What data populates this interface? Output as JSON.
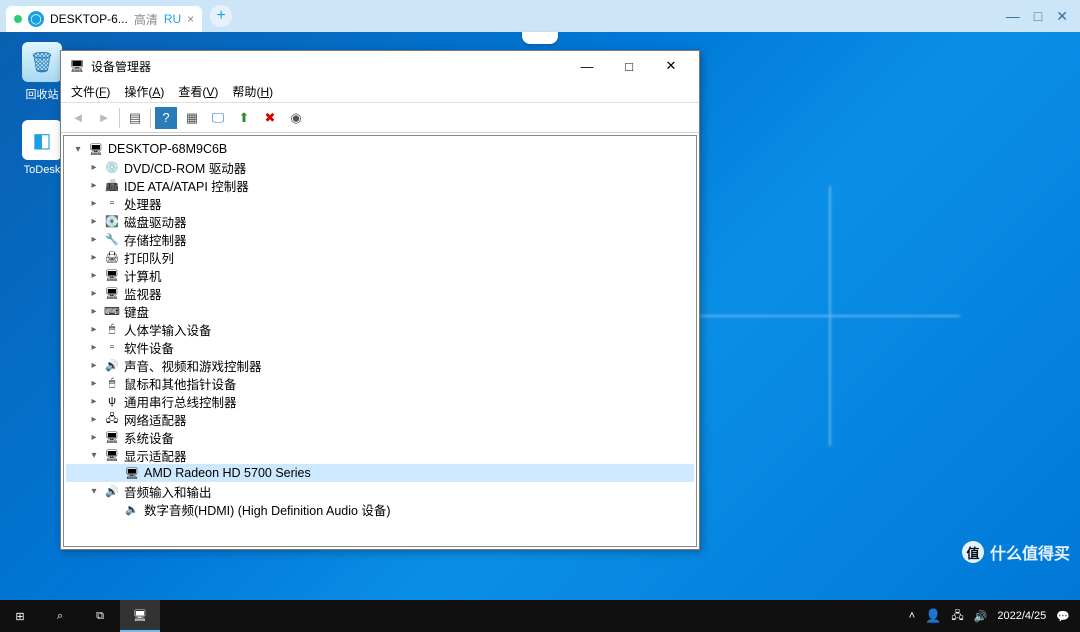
{
  "app_tab": {
    "title": "DESKTOP-6...",
    "quality": "高清",
    "lang": "RU"
  },
  "desktop_icons": [
    {
      "label": "回收站",
      "kind": "recycle"
    },
    {
      "label": "ToDesk",
      "kind": "todesk"
    }
  ],
  "device_manager": {
    "title": "设备管理器",
    "menu": [
      {
        "label": "文件",
        "hotkey": "F"
      },
      {
        "label": "操作",
        "hotkey": "A"
      },
      {
        "label": "查看",
        "hotkey": "V"
      },
      {
        "label": "帮助",
        "hotkey": "H"
      }
    ],
    "root": "DESKTOP-68M9C6B",
    "categories": [
      {
        "label": "DVD/CD-ROM 驱动器",
        "icon": "💿"
      },
      {
        "label": "IDE ATA/ATAPI 控制器",
        "icon": "📠"
      },
      {
        "label": "处理器",
        "icon": "▫"
      },
      {
        "label": "磁盘驱动器",
        "icon": "💽"
      },
      {
        "label": "存储控制器",
        "icon": "🔧"
      },
      {
        "label": "打印队列",
        "icon": "🖨"
      },
      {
        "label": "计算机",
        "icon": "🖥"
      },
      {
        "label": "监视器",
        "icon": "🖥"
      },
      {
        "label": "键盘",
        "icon": "⌨"
      },
      {
        "label": "人体学输入设备",
        "icon": "🖱"
      },
      {
        "label": "软件设备",
        "icon": "▫"
      },
      {
        "label": "声音、视频和游戏控制器",
        "icon": "🔊"
      },
      {
        "label": "鼠标和其他指针设备",
        "icon": "🖱"
      },
      {
        "label": "通用串行总线控制器",
        "icon": "ψ"
      },
      {
        "label": "网络适配器",
        "icon": "🖧"
      },
      {
        "label": "系统设备",
        "icon": "🖥"
      }
    ],
    "display_adapters": {
      "label": "显示适配器",
      "children": [
        {
          "label": "AMD Radeon HD 5700 Series",
          "selected": true
        }
      ]
    },
    "audio_io": {
      "label": "音频输入和输出",
      "children": [
        {
          "label": "数字音频(HDMI) (High Definition Audio 设备)"
        }
      ]
    }
  },
  "taskbar": {
    "date": "2022/4/25"
  },
  "watermark": "什么值得买"
}
